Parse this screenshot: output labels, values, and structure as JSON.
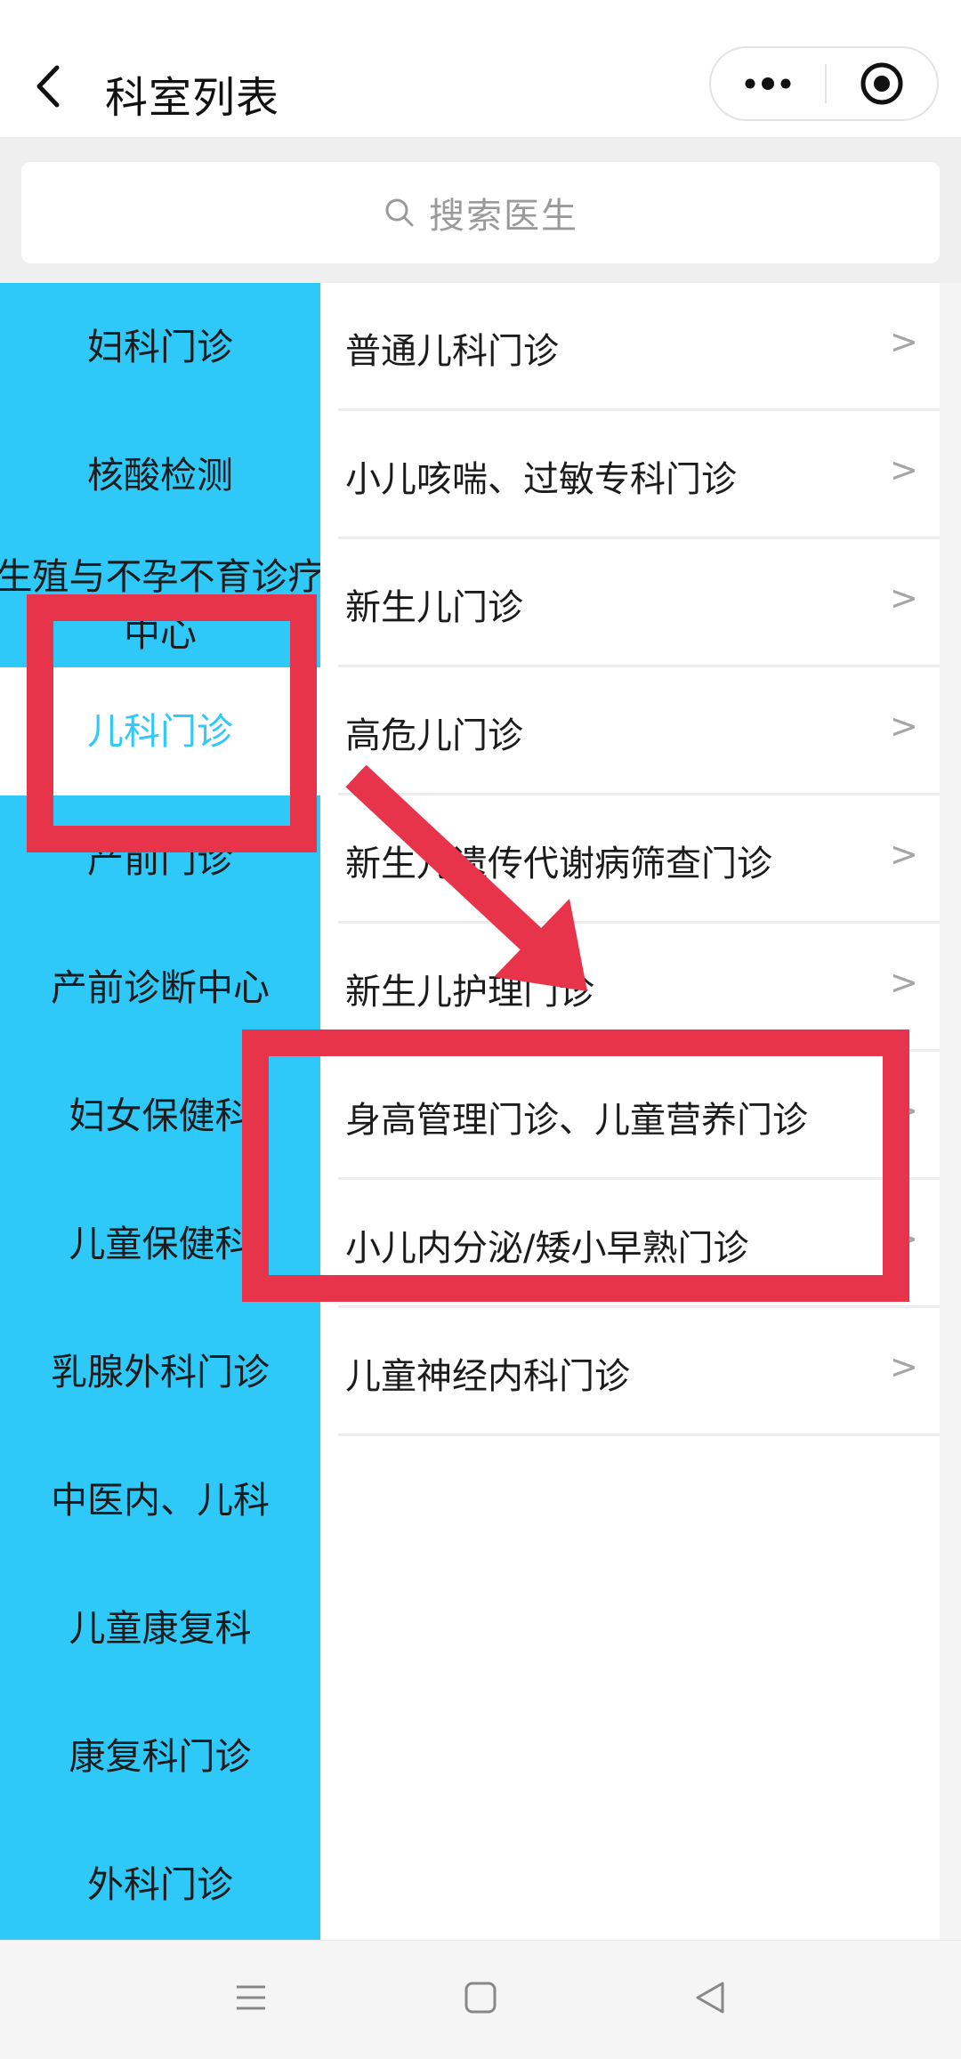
{
  "header": {
    "title": "科室列表",
    "back_icon": "chevron-left-icon",
    "more_icon": "more-dots-icon",
    "close_icon": "target-close-icon"
  },
  "search": {
    "placeholder": "搜索医生",
    "icon": "search-icon"
  },
  "sidebar": {
    "active_index": 3,
    "items": [
      {
        "label": "妇科门诊"
      },
      {
        "label": "核酸检测"
      },
      {
        "label": "生殖与不孕不育诊疗中心"
      },
      {
        "label": "儿科门诊"
      },
      {
        "label": "产前门诊"
      },
      {
        "label": "产前诊断中心"
      },
      {
        "label": "妇女保健科"
      },
      {
        "label": "儿童保健科"
      },
      {
        "label": "乳腺外科门诊"
      },
      {
        "label": "中医内、儿科"
      },
      {
        "label": "儿童康复科"
      },
      {
        "label": "康复科门诊"
      },
      {
        "label": "外科门诊"
      }
    ]
  },
  "departments": {
    "arrow": ">",
    "items": [
      {
        "label": "普通儿科门诊"
      },
      {
        "label": "小儿咳喘、过敏专科门诊"
      },
      {
        "label": "新生儿门诊"
      },
      {
        "label": "高危儿门诊"
      },
      {
        "label": "新生儿遗传代谢病筛查门诊"
      },
      {
        "label": "新生儿护理门诊"
      },
      {
        "label": "身高管理门诊、儿童营养门诊"
      },
      {
        "label": "小儿内分泌/矮小早熟门诊"
      },
      {
        "label": "儿童神经内科门诊"
      }
    ]
  },
  "annotation": {
    "color": "#e8344b",
    "icon": "arrow-annotation-icon"
  },
  "system_nav": {
    "menu_icon": "menu-lines-icon",
    "home_icon": "square-home-icon",
    "back_icon": "triangle-back-icon"
  },
  "colors": {
    "sidebar_bg": "#2ec9f9",
    "active_text": "#2ec9f9"
  }
}
